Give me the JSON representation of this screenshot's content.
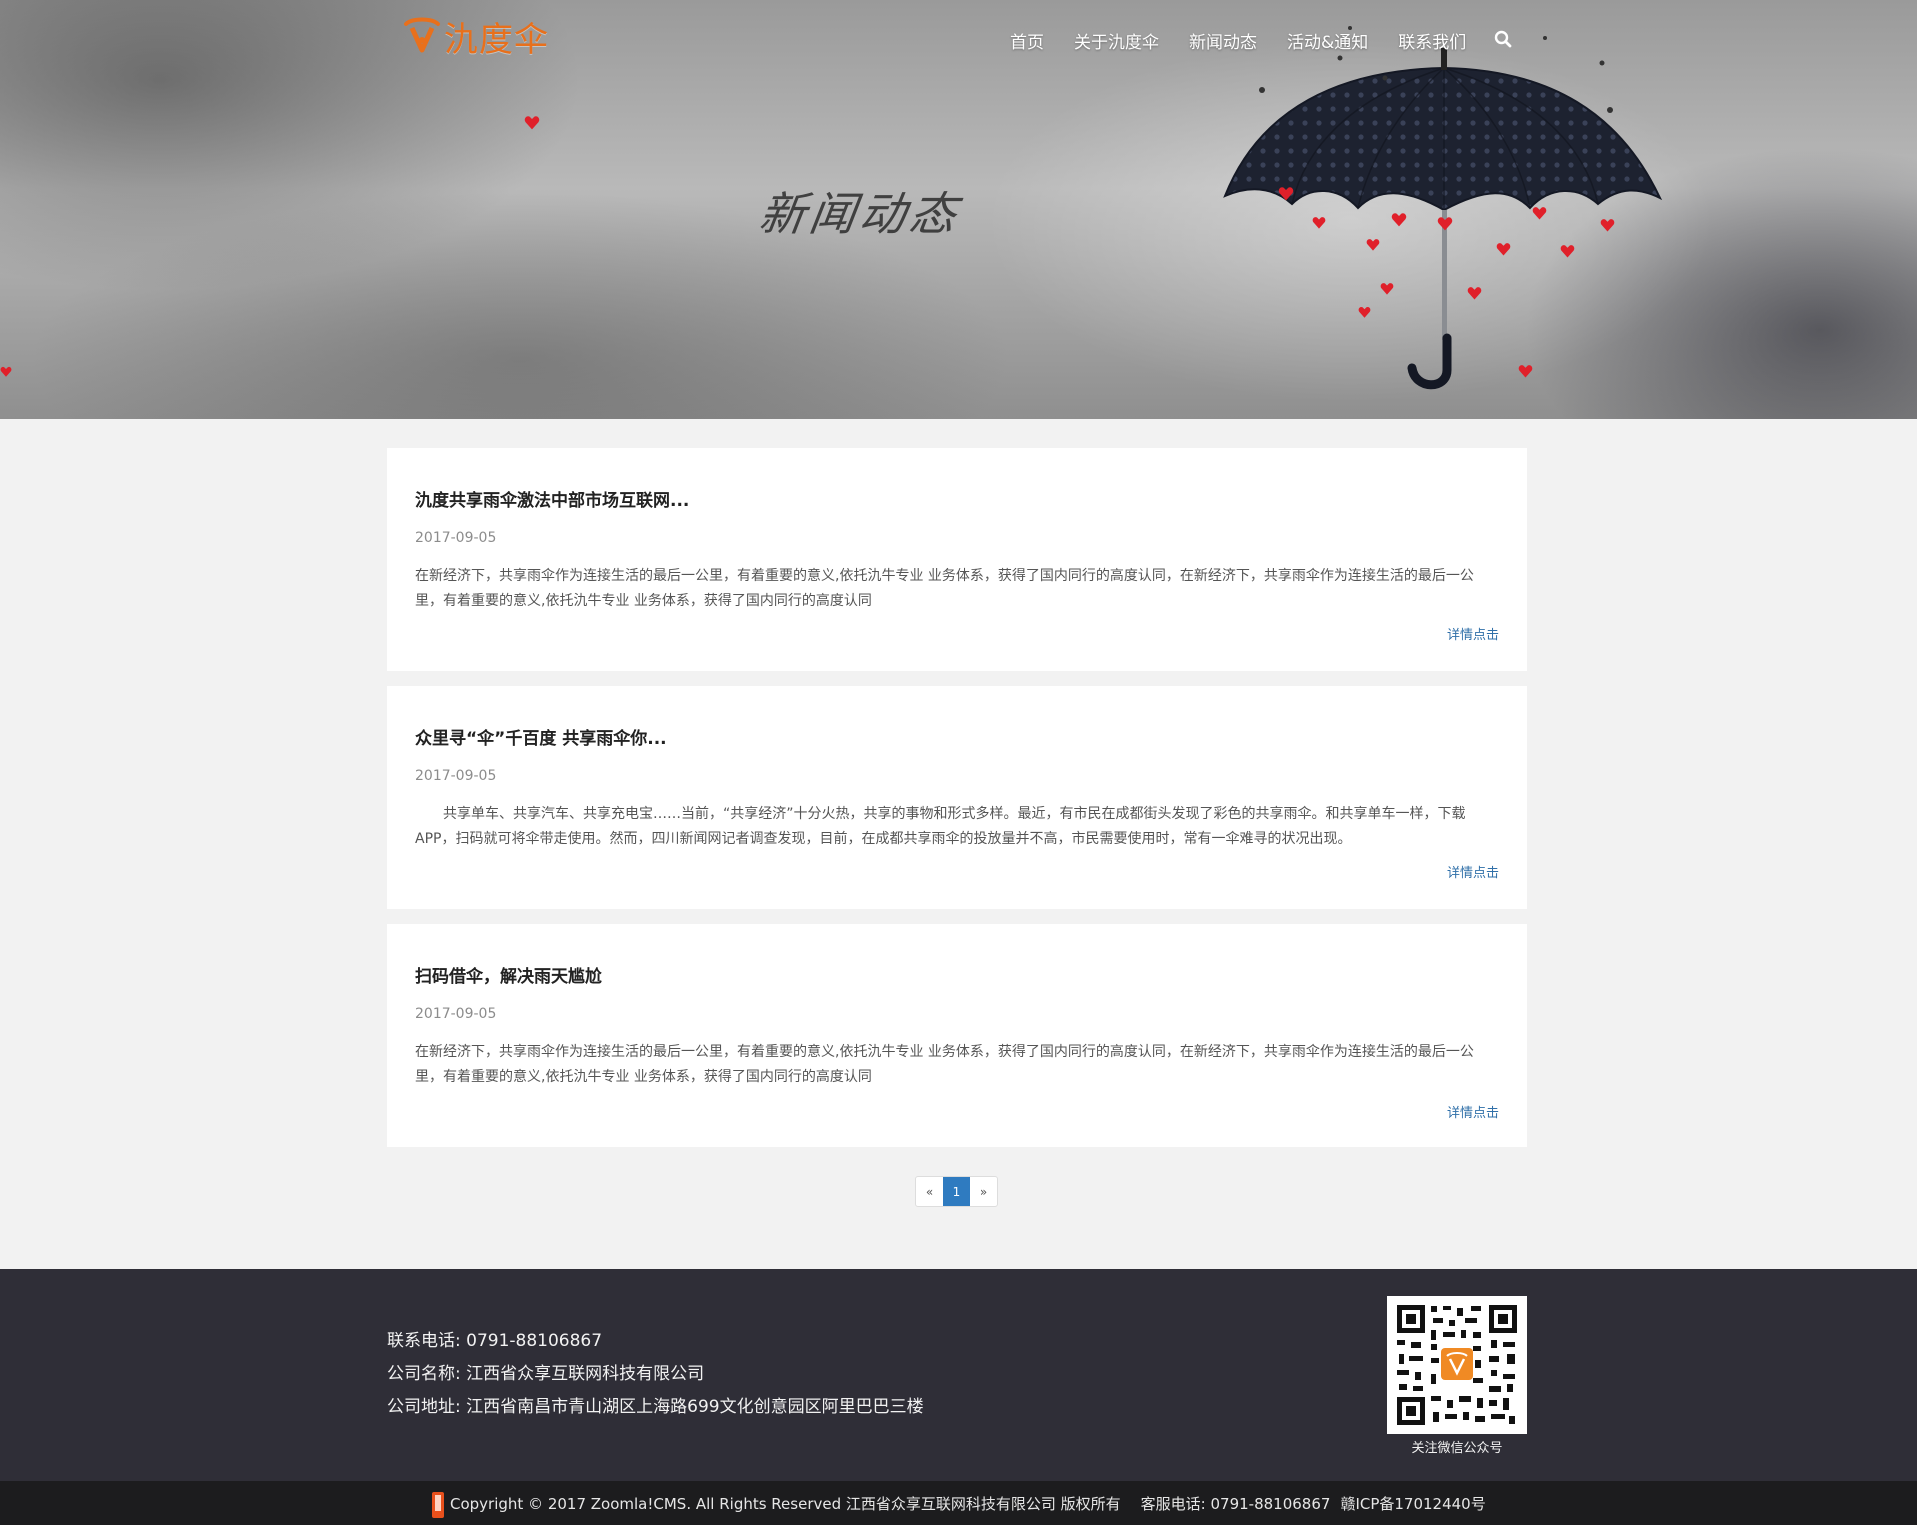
{
  "header": {
    "logo_text": "氿度伞",
    "nav": [
      {
        "label": "首页"
      },
      {
        "label": "关于氿度伞"
      },
      {
        "label": "新闻动态"
      },
      {
        "label": "活动&通知"
      },
      {
        "label": "联系我们"
      }
    ],
    "search_icon": "search-icon",
    "hero_title": "新闻动态"
  },
  "articles": [
    {
      "title": "氿度共享雨伞激法中部市场互联网...",
      "date": "2017-09-05",
      "summary": "在新经济下，共享雨伞作为连接生活的最后一公里，有着重要的意义,依托氿牛专业 业务体系，获得了国内同行的高度认同，在新经济下，共享雨伞作为连接生活的最后一公里，有着重要的意义,依托氿牛专业 业务体系，获得了国内同行的高度认同",
      "more": "详情点击"
    },
    {
      "title": "众里寻“伞”千百度 共享雨伞你...",
      "date": "2017-09-05",
      "summary": "　　共享单车、共享汽车、共享充电宝……当前，“共享经济”十分火热，共享的事物和形式多样。最近，有市民在成都街头发现了彩色的共享雨伞。和共享单车一样，下载APP，扫码就可将伞带走使用。然而，四川新闻网记者调查发现，目前，在成都共享雨伞的投放量并不高，市民需要使用时，常有一伞难寻的状况出现。",
      "more": "详情点击"
    },
    {
      "title": "扫码借伞，解决雨天尴尬",
      "date": "2017-09-05",
      "summary": "在新经济下，共享雨伞作为连接生活的最后一公里，有着重要的意义,依托氿牛专业 业务体系，获得了国内同行的高度认同，在新经济下，共享雨伞作为连接生活的最后一公里，有着重要的意义,依托氿牛专业 业务体系，获得了国内同行的高度认同",
      "more": "详情点击"
    }
  ],
  "pagination": {
    "prev": "«",
    "current": "1",
    "next": "»"
  },
  "footer": {
    "phone": "联系电话: 0791-88106867",
    "company": "公司名称: 江西省众享互联网科技有限公司",
    "address": "公司地址: 江西省南昌市青山湖区上海路699文化创意园区阿里巴巴三楼",
    "qr_caption": "关注微信公众号",
    "copyright": "Copyright © 2017 Zoomla!CMS. All Rights Reserved 江西省众享互联网科技有限公司 版权所有",
    "service_phone": "客服电话: 0791-88106867",
    "icp": "赣ICP备17012440号"
  },
  "colors": {
    "brand_orange": "#e8701c",
    "link_blue": "#2f6fa8",
    "pager_active": "#2f7bc0",
    "footer_bg": "#2f2e37",
    "copyright_bg": "#1c1c1e",
    "heart_red": "#e0202a"
  }
}
